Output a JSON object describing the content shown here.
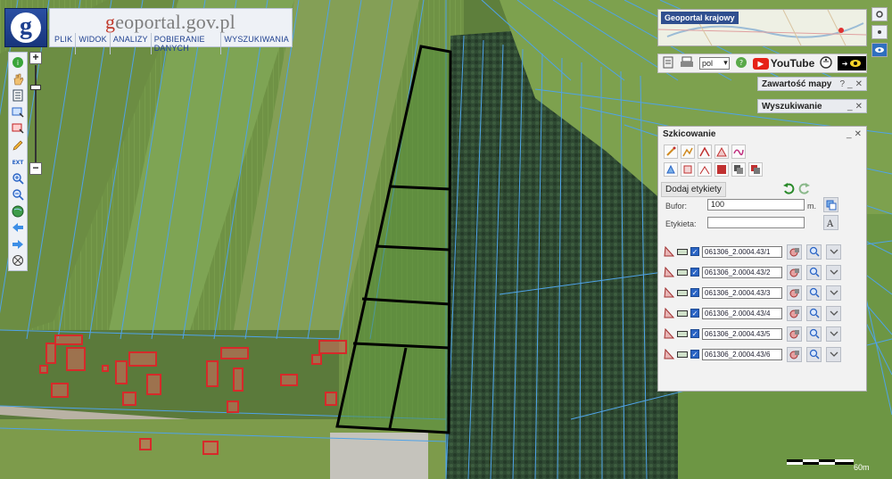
{
  "header": {
    "site_prefix": "g",
    "site_name": "eoportal.gov.pl",
    "menu": [
      "PLIK",
      "WIDOK",
      "ANALIZY",
      "POBIERANIE DANYCH",
      "WYSZUKIWANIA"
    ]
  },
  "overview": {
    "title": "Geoportal krajowy"
  },
  "iconbar": {
    "language": "pol",
    "youtube": "YouTube"
  },
  "panels": {
    "zawartosc": {
      "title": "Zawartość mapy",
      "help": "?"
    },
    "wyszukiwanie": {
      "title": "Wyszukiwanie"
    }
  },
  "sketch": {
    "title": "Szkicowanie",
    "add_labels": "Dodaj etykiety",
    "buffer_label": "Bufor:",
    "buffer_value": "100",
    "buffer_unit": "m.",
    "label_label": "Etykieta:",
    "label_value": "",
    "layers": [
      "061306_2.0004.43/1",
      "061306_2.0004.43/2",
      "061306_2.0004.43/3",
      "061306_2.0004.43/4",
      "061306_2.0004.43/5",
      "061306_2.0004.43/6"
    ]
  },
  "scale": {
    "label": "60m"
  },
  "colors": {
    "parcel_outline": "#000000",
    "building": "#d63a3a",
    "cadastral_lines": "#4fa3e8",
    "panel_title": "#2f4f8f"
  }
}
